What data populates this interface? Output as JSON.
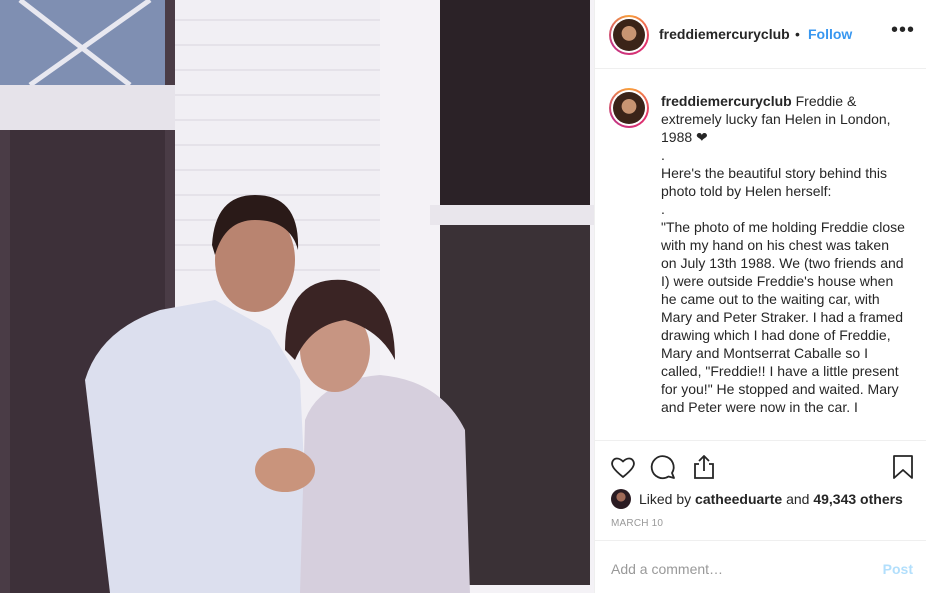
{
  "post": {
    "username": "freddiemercuryclub",
    "separator": "•",
    "follow_label": "Follow",
    "more_label": "•••",
    "caption": {
      "username": "freddiemercuryclub",
      "lines": [
        "Freddie & extremely lucky fan Helen in London, 1988 ❤",
        ".",
        "Here's the beautiful story behind this photo told by Helen herself:",
        ".",
        "\"The photo of me holding Freddie close with my hand on his chest was taken on July 13th 1988. We (two friends and I) were outside Freddie's house when he came out to the waiting car, with Mary and Peter Straker.  I had a framed drawing which I had done of Freddie, Mary and Montserrat Caballe  so I called, \"Freddie!! I have a little present for you!\" He stopped and waited. Mary and Peter were now in the car. I"
      ]
    },
    "likes": {
      "prefix": "Liked by ",
      "user": "catheeduarte",
      "middle": " and ",
      "count": "49,343 others"
    },
    "date": "MARCH 10",
    "comment": {
      "placeholder": "Add a comment…",
      "post_label": "Post"
    },
    "icons": {
      "like": "heart-icon",
      "comment": "comment-icon",
      "share": "share-icon",
      "save": "bookmark-icon",
      "more": "more-options-icon"
    },
    "colors": {
      "link_blue": "#3897f0",
      "post_disabled": "#b2dffc",
      "muted_gray": "#999999",
      "text": "#262626"
    }
  }
}
